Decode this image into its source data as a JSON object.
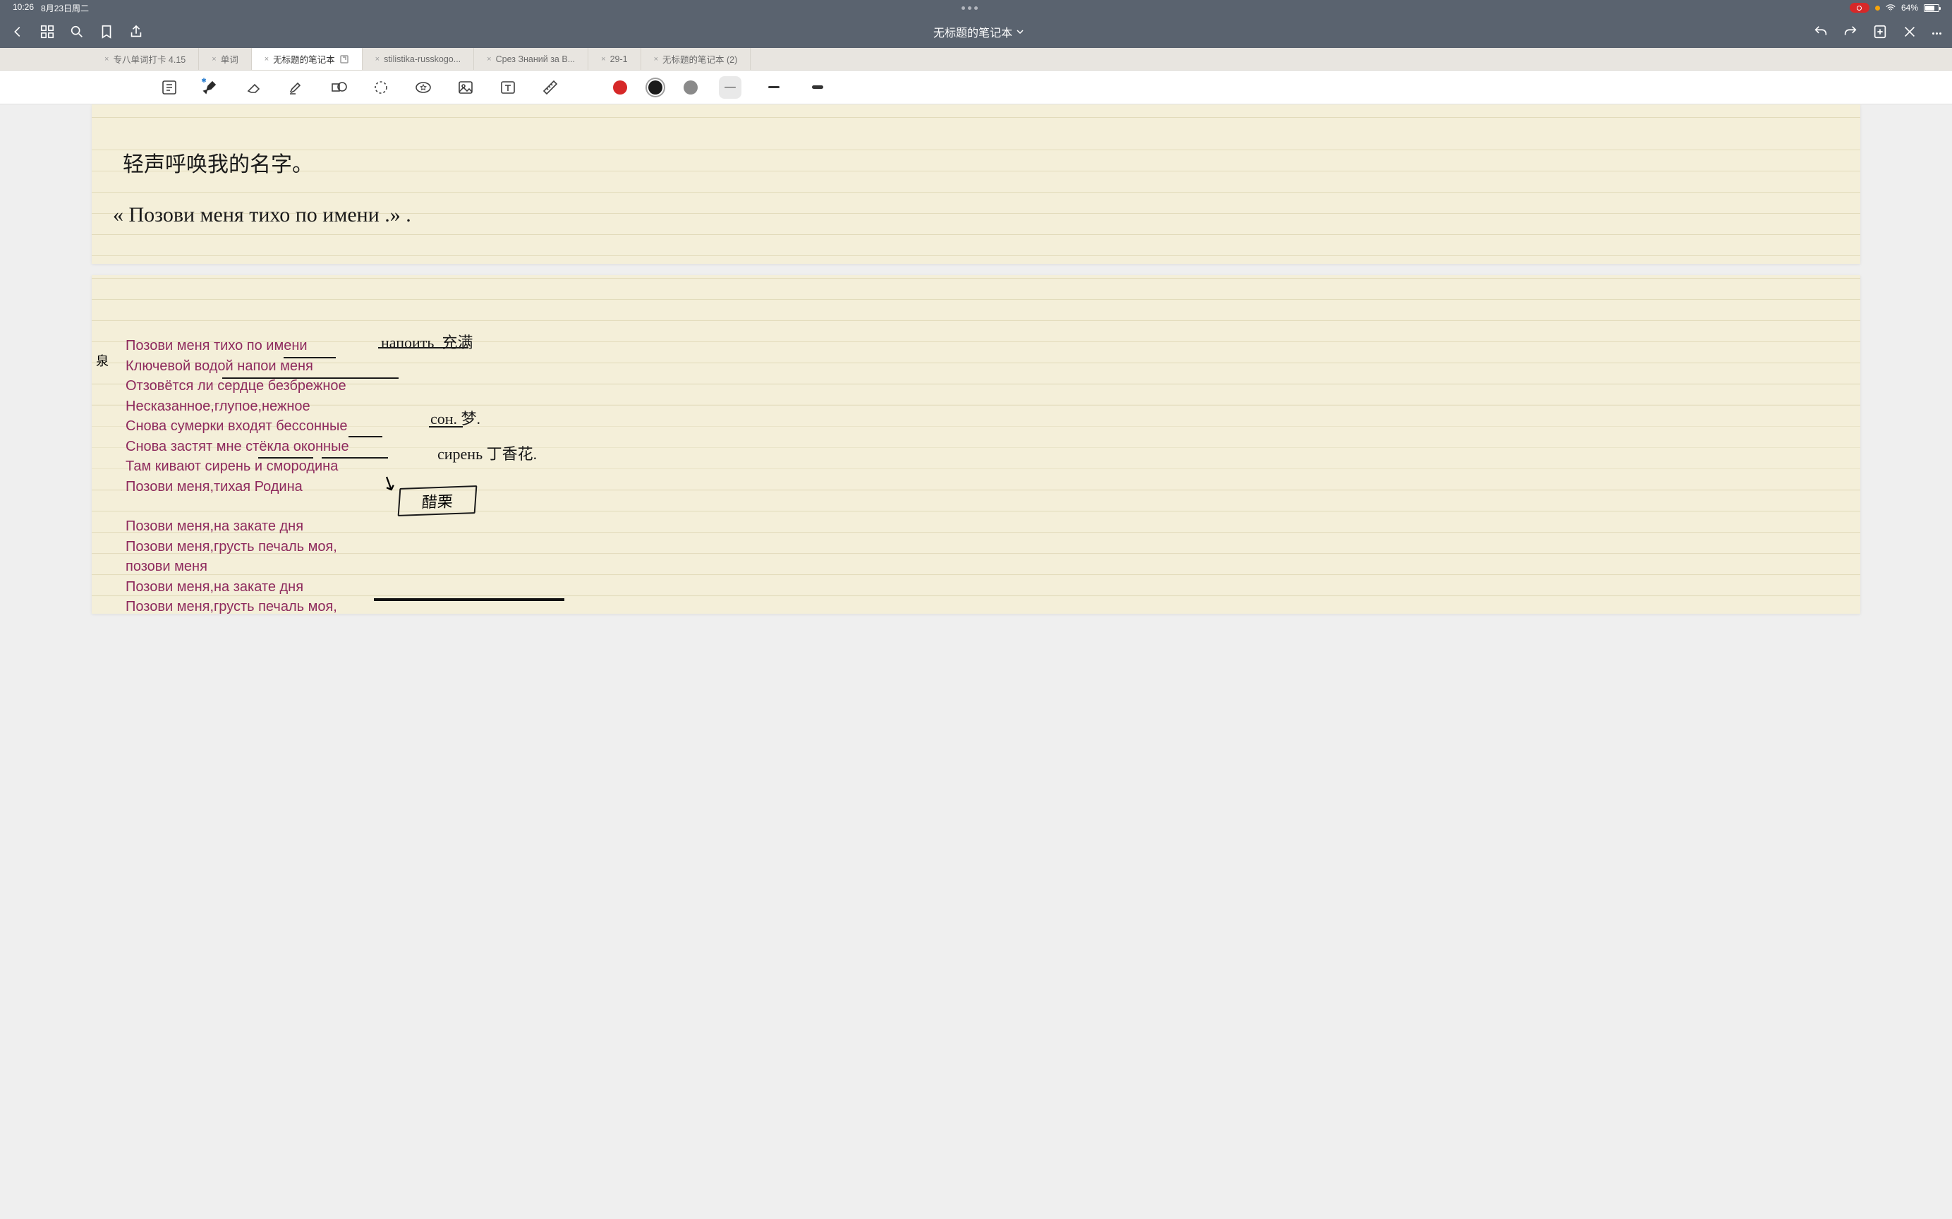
{
  "status_bar": {
    "time": "10:26",
    "date": "8月23日周二",
    "battery_pct": "64%"
  },
  "header": {
    "title": "无标题的笔记本"
  },
  "tabs": [
    {
      "label": "专八单词打卡 4.15",
      "active": false,
      "special": false
    },
    {
      "label": "单词",
      "active": false,
      "special": false
    },
    {
      "label": "无标题的笔记本",
      "active": true,
      "special": true
    },
    {
      "label": "stilistika-russkogo...",
      "active": false,
      "special": false
    },
    {
      "label": "Срез Знаний за В...",
      "active": false,
      "special": false
    },
    {
      "label": "29-1",
      "active": false,
      "special": false
    },
    {
      "label": "无标题的笔记本 (2)",
      "active": false,
      "special": false
    }
  ],
  "colors": {
    "accent": "#d62828",
    "ink": "#1a1a1a",
    "paper": "#f4efd9",
    "text_typed": "#8e2a5d"
  },
  "toolbar": {
    "tools": [
      "reader-mode-icon",
      "pen-tool-icon",
      "eraser-tool-icon",
      "highlighter-tool-icon",
      "shape-tool-icon",
      "lasso-tool-icon",
      "favorites-tool-icon",
      "image-tool-icon",
      "text-tool-icon",
      "ruler-tool-icon"
    ],
    "active_tool": "pen-tool-icon",
    "colors": [
      "#d62828",
      "#1a1a1a",
      "#8a8a8a"
    ],
    "selected_color_index": 1,
    "strokes": [
      "thin",
      "medium",
      "thick"
    ],
    "selected_stroke_index": 0
  },
  "handwriting": {
    "page1_line1": "轻声呼唤我的名字。",
    "page1_line2": "« Позови  меня  тихо  по  имени .» .",
    "note_left": "泉",
    "anno1_ru": "напоить",
    "anno1_cn": "充满",
    "anno2_ru": "сон.",
    "anno2_cn": "梦.",
    "anno3_ru": "сирень",
    "anno3_cn": "丁香花.",
    "box_label": "醋栗"
  },
  "typed": {
    "stanza1": [
      "Позови меня тихо по имени",
      "Ключевой водой напои меня",
      "Отзовётся ли сердце безбрежное",
      "Несказанное,глупое,нежное",
      "Снова сумерки входят бессонные",
      "Снова застят мне стёкла оконные",
      "Там кивают сирень и смородина",
      "Позови меня,тихая Родина"
    ],
    "stanza2": [
      "Позови меня,на закате дня",
      "Позови меня,грусть печаль моя,",
      "позови меня",
      "Позови меня,на закате дня",
      "Позови меня,грусть печаль моя,"
    ]
  }
}
